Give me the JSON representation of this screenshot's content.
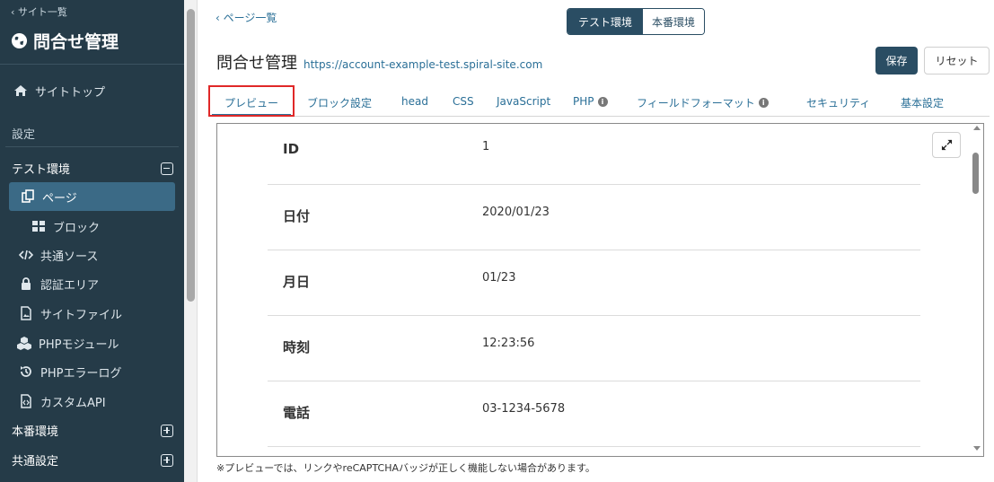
{
  "sidebar": {
    "back_label": "‹ サイト一覧",
    "site_title": "問合せ管理",
    "site_top": "サイトトップ",
    "settings_section": "設定",
    "test_env": "テスト環境",
    "items": [
      {
        "label": "ページ",
        "icon": "pages-icon"
      },
      {
        "label": "ブロック",
        "icon": "block-icon"
      },
      {
        "label": "共通ソース",
        "icon": "code-icon"
      },
      {
        "label": "認証エリア",
        "icon": "lock-icon"
      },
      {
        "label": "サイトファイル",
        "icon": "image-file-icon"
      },
      {
        "label": "PHPモジュール",
        "icon": "cubes-icon"
      },
      {
        "label": "PHPエラーログ",
        "icon": "history-icon"
      },
      {
        "label": "カスタムAPI",
        "icon": "api-file-icon"
      }
    ],
    "prod_env": "本番環境",
    "common_settings": "共通設定"
  },
  "header": {
    "breadcrumb": "‹  ページ一覧",
    "env_test": "テスト環境",
    "env_prod": "本番環境",
    "title": "問合せ管理",
    "url": "https://account-example-test.spiral-site.com",
    "save_label": "保存",
    "reset_label": "リセット"
  },
  "tabs": [
    {
      "label": "プレビュー",
      "active": true
    },
    {
      "label": "ブロック設定"
    },
    {
      "label": "head"
    },
    {
      "label": "CSS"
    },
    {
      "label": "JavaScript"
    },
    {
      "label": "PHP",
      "info": true
    },
    {
      "label": "フィールドフォーマット",
      "info": true
    },
    {
      "label": "セキュリティ"
    },
    {
      "label": "基本設定"
    }
  ],
  "preview_rows": [
    {
      "label": "ID",
      "value": "1"
    },
    {
      "label": "日付",
      "value": "2020/01/23"
    },
    {
      "label": "月日",
      "value": "01/23"
    },
    {
      "label": "時刻",
      "value": "12:23:56"
    },
    {
      "label": "電話",
      "value": "03-1234-5678"
    }
  ],
  "footer_note": "※プレビューでは、リンクやreCAPTCHAバッジが正しく機能しない場合があります。",
  "colors": {
    "sidebar_bg": "#253b48",
    "accent": "#2a4d63",
    "link": "#2a6f97",
    "highlight": "#e02828"
  }
}
